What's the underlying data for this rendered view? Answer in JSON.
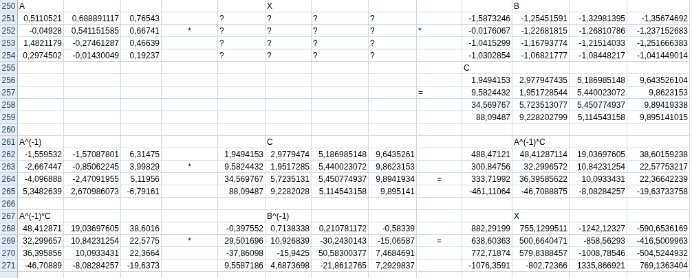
{
  "rows": [
    {
      "number": "250",
      "cells": [
        {
          "kind": "label",
          "text": "A"
        },
        null,
        null,
        null,
        null,
        {
          "kind": "label",
          "text": "X"
        },
        null,
        null,
        null,
        null,
        {
          "kind": "label",
          "text": "B"
        },
        null,
        null
      ]
    },
    {
      "number": "251",
      "cells": [
        {
          "kind": "number",
          "text": "0,5110521"
        },
        {
          "kind": "number",
          "text": "0,688891117"
        },
        {
          "kind": "number",
          "text": "0,76543"
        },
        null,
        {
          "kind": "label",
          "text": "?"
        },
        {
          "kind": "label",
          "text": "?"
        },
        {
          "kind": "label",
          "text": "?"
        },
        {
          "kind": "label",
          "text": "?"
        },
        null,
        {
          "kind": "number",
          "text": "-1,5873246"
        },
        {
          "kind": "number",
          "text": "-1,25451591"
        },
        {
          "kind": "number",
          "text": "-1,32981395"
        },
        {
          "kind": "number",
          "text": "-1,35674692"
        }
      ]
    },
    {
      "number": "252",
      "cells": [
        {
          "kind": "number",
          "text": "-0,04928"
        },
        {
          "kind": "number",
          "text": "0,541151585"
        },
        {
          "kind": "number",
          "text": "0,66741"
        },
        {
          "kind": "operator",
          "text": "*"
        },
        {
          "kind": "label",
          "text": "?"
        },
        {
          "kind": "label",
          "text": "?"
        },
        {
          "kind": "label",
          "text": "?"
        },
        {
          "kind": "label",
          "text": "?"
        },
        {
          "kind": "label",
          "text": "*"
        },
        {
          "kind": "number",
          "text": "-0,0176067"
        },
        {
          "kind": "number",
          "text": "-1,22681815"
        },
        {
          "kind": "number",
          "text": "-1,26810786"
        },
        {
          "kind": "number",
          "text": "-1,237152683"
        }
      ]
    },
    {
      "number": "253",
      "cells": [
        {
          "kind": "number",
          "text": "1,4821179"
        },
        {
          "kind": "number",
          "text": "-0,27461287"
        },
        {
          "kind": "number",
          "text": "0,46639"
        },
        null,
        {
          "kind": "label",
          "text": "?"
        },
        {
          "kind": "label",
          "text": "?"
        },
        {
          "kind": "label",
          "text": "?"
        },
        {
          "kind": "label",
          "text": "?"
        },
        null,
        {
          "kind": "number",
          "text": "-1,0415299"
        },
        {
          "kind": "number",
          "text": "-1,16793774"
        },
        {
          "kind": "number",
          "text": "-1,21514033"
        },
        {
          "kind": "number",
          "text": "-1,251666383"
        }
      ]
    },
    {
      "number": "254",
      "cells": [
        {
          "kind": "number",
          "text": "0,2974502"
        },
        {
          "kind": "number",
          "text": "-0,01430049"
        },
        {
          "kind": "number",
          "text": "0,19237"
        },
        null,
        {
          "kind": "label",
          "text": "?"
        },
        {
          "kind": "label",
          "text": "?"
        },
        {
          "kind": "label",
          "text": "?"
        },
        {
          "kind": "label",
          "text": "?"
        },
        null,
        {
          "kind": "number",
          "text": "-1,0302854"
        },
        {
          "kind": "number",
          "text": "-1,06821777"
        },
        {
          "kind": "number",
          "text": "-1,08448217"
        },
        {
          "kind": "number",
          "text": "-1,041449014"
        }
      ]
    },
    {
      "number": "255",
      "cells": [
        null,
        null,
        null,
        null,
        null,
        null,
        null,
        null,
        null,
        {
          "kind": "label",
          "text": "C"
        },
        null,
        null,
        null
      ]
    },
    {
      "number": "256",
      "cells": [
        null,
        null,
        null,
        null,
        null,
        null,
        null,
        null,
        null,
        {
          "kind": "number",
          "text": "1,9494153"
        },
        {
          "kind": "number",
          "text": "2,977947435"
        },
        {
          "kind": "number",
          "text": "5,186985148"
        },
        {
          "kind": "number",
          "text": "9,643526104"
        }
      ]
    },
    {
      "number": "257",
      "cells": [
        null,
        null,
        null,
        null,
        null,
        null,
        null,
        null,
        {
          "kind": "label",
          "text": "="
        },
        {
          "kind": "number",
          "text": "9,5824432"
        },
        {
          "kind": "number",
          "text": "1,951728544"
        },
        {
          "kind": "number",
          "text": "5,440023072"
        },
        {
          "kind": "number",
          "text": "9,8623153"
        }
      ]
    },
    {
      "number": "258",
      "cells": [
        null,
        null,
        null,
        null,
        null,
        null,
        null,
        null,
        null,
        {
          "kind": "number",
          "text": "34,569767"
        },
        {
          "kind": "number",
          "text": "5,723513077"
        },
        {
          "kind": "number",
          "text": "5,450774937"
        },
        {
          "kind": "number",
          "text": "9,89419338"
        }
      ]
    },
    {
      "number": "259",
      "cells": [
        null,
        null,
        null,
        null,
        null,
        null,
        null,
        null,
        null,
        {
          "kind": "number",
          "text": "88,09487"
        },
        {
          "kind": "number",
          "text": "9,228202799"
        },
        {
          "kind": "number",
          "text": "5,114543158"
        },
        {
          "kind": "number",
          "text": "9,895141015"
        }
      ]
    },
    {
      "number": "260",
      "cells": [
        null,
        null,
        null,
        null,
        null,
        null,
        null,
        null,
        null,
        null,
        null,
        null,
        null
      ]
    },
    {
      "number": "261",
      "cells": [
        {
          "kind": "label",
          "text": "A^(-1)"
        },
        null,
        null,
        null,
        null,
        {
          "kind": "label",
          "text": "C"
        },
        null,
        null,
        null,
        null,
        {
          "kind": "label",
          "text": "A^(-1)*C"
        },
        null,
        null
      ]
    },
    {
      "number": "262",
      "cells": [
        {
          "kind": "number",
          "text": "-1,559532"
        },
        {
          "kind": "number",
          "text": "-1,57087801"
        },
        {
          "kind": "number",
          "text": "6,31475"
        },
        null,
        {
          "kind": "number",
          "text": "1,9494153"
        },
        {
          "kind": "number",
          "text": "2,9779474"
        },
        {
          "kind": "number",
          "text": "5,186985148"
        },
        {
          "kind": "number",
          "text": "9,6435261"
        },
        null,
        {
          "kind": "number",
          "text": "488,47121"
        },
        {
          "kind": "number",
          "text": "48,41287114"
        },
        {
          "kind": "number",
          "text": "19,03697605"
        },
        {
          "kind": "number",
          "text": "38,60159238"
        }
      ]
    },
    {
      "number": "263",
      "cells": [
        {
          "kind": "number",
          "text": "-2,667447"
        },
        {
          "kind": "number",
          "text": "-0,85062245"
        },
        {
          "kind": "number",
          "text": "3,99829"
        },
        {
          "kind": "operator",
          "text": "*"
        },
        {
          "kind": "number",
          "text": "9,5824432"
        },
        {
          "kind": "number",
          "text": "1,9517285"
        },
        {
          "kind": "number",
          "text": "5,440023072"
        },
        {
          "kind": "number",
          "text": "9,8623153"
        },
        null,
        {
          "kind": "number",
          "text": "300,84756"
        },
        {
          "kind": "number",
          "text": "32,2996572"
        },
        {
          "kind": "number",
          "text": "10,84231254"
        },
        {
          "kind": "number",
          "text": "22,57753217"
        }
      ]
    },
    {
      "number": "264",
      "cells": [
        {
          "kind": "number",
          "text": "-4,096888"
        },
        {
          "kind": "number",
          "text": "-2,47091955"
        },
        {
          "kind": "number",
          "text": "5,11956"
        },
        null,
        {
          "kind": "number",
          "text": "34,569767"
        },
        {
          "kind": "number",
          "text": "5,7235131"
        },
        {
          "kind": "number",
          "text": "5,450774937"
        },
        {
          "kind": "number",
          "text": "9,8941934"
        },
        {
          "kind": "operator",
          "text": "="
        },
        {
          "kind": "number",
          "text": "333,71992"
        },
        {
          "kind": "number",
          "text": "36,39585622"
        },
        {
          "kind": "number",
          "text": "10,0933431"
        },
        {
          "kind": "number",
          "text": "22,36642239"
        }
      ]
    },
    {
      "number": "265",
      "cells": [
        {
          "kind": "number",
          "text": "5,3482639"
        },
        {
          "kind": "number",
          "text": "2,670986073"
        },
        {
          "kind": "number",
          "text": "-6,79161"
        },
        null,
        {
          "kind": "number",
          "text": "88,09487"
        },
        {
          "kind": "number",
          "text": "9,2282028"
        },
        {
          "kind": "number",
          "text": "5,114543158"
        },
        {
          "kind": "number",
          "text": "9,895141"
        },
        null,
        {
          "kind": "number",
          "text": "-461,11064"
        },
        {
          "kind": "number",
          "text": "-46,7088875"
        },
        {
          "kind": "number",
          "text": "-8,08284257"
        },
        {
          "kind": "number",
          "text": "-19,63733758"
        }
      ]
    },
    {
      "number": "266",
      "cells": [
        null,
        null,
        null,
        null,
        null,
        null,
        null,
        null,
        null,
        null,
        null,
        null,
        null
      ]
    },
    {
      "number": "267",
      "cells": [
        {
          "kind": "label",
          "text": "A^(-1)*C"
        },
        null,
        null,
        null,
        null,
        {
          "kind": "label",
          "text": "B^(-1)"
        },
        null,
        null,
        null,
        null,
        {
          "kind": "label",
          "text": "X"
        },
        null,
        null
      ]
    },
    {
      "number": "268",
      "cells": [
        {
          "kind": "number",
          "text": "48,412871"
        },
        {
          "kind": "number",
          "text": "19,03697605"
        },
        {
          "kind": "number",
          "text": "38,6016"
        },
        null,
        {
          "kind": "number",
          "text": "-0,397552"
        },
        {
          "kind": "number",
          "text": "0,7138338"
        },
        {
          "kind": "number",
          "text": "0,210781172"
        },
        {
          "kind": "number",
          "text": "-0,58339"
        },
        null,
        {
          "kind": "number",
          "text": "882,29199"
        },
        {
          "kind": "number",
          "text": "755,1299511"
        },
        {
          "kind": "number",
          "text": "-1242,12327"
        },
        {
          "kind": "number",
          "text": "-590,6536169"
        }
      ]
    },
    {
      "number": "269",
      "cells": [
        {
          "kind": "number",
          "text": "32,299657"
        },
        {
          "kind": "number",
          "text": "10,84231254"
        },
        {
          "kind": "number",
          "text": "22,5775"
        },
        {
          "kind": "operator",
          "text": "*"
        },
        {
          "kind": "number",
          "text": "29,501696"
        },
        {
          "kind": "number",
          "text": "10,926839"
        },
        {
          "kind": "number",
          "text": "-30,2430143"
        },
        {
          "kind": "number",
          "text": "-15,06587"
        },
        {
          "kind": "operator",
          "text": "="
        },
        {
          "kind": "number",
          "text": "638,60363"
        },
        {
          "kind": "number",
          "text": "500,6640471"
        },
        {
          "kind": "number",
          "text": "-858,56293"
        },
        {
          "kind": "number",
          "text": "-416,5009963"
        }
      ]
    },
    {
      "number": "270",
      "cells": [
        {
          "kind": "number",
          "text": "36,395856"
        },
        {
          "kind": "number",
          "text": "10,0933431"
        },
        {
          "kind": "number",
          "text": "22,3664"
        },
        null,
        {
          "kind": "number",
          "text": "-37,86098"
        },
        {
          "kind": "number",
          "text": "-15,9425"
        },
        {
          "kind": "number",
          "text": "50,58300377"
        },
        {
          "kind": "number",
          "text": "7,4684691"
        },
        null,
        {
          "kind": "number",
          "text": "772,71874"
        },
        {
          "kind": "number",
          "text": "579,8388457"
        },
        {
          "kind": "number",
          "text": "-1008,78546"
        },
        {
          "kind": "number",
          "text": "-504,5244932"
        }
      ]
    },
    {
      "number": "271",
      "cells": [
        {
          "kind": "number",
          "text": "-46,70889"
        },
        {
          "kind": "number",
          "text": "-8,08284257"
        },
        {
          "kind": "number",
          "text": "-19,6373"
        },
        null,
        {
          "kind": "number",
          "text": "9,5587186"
        },
        {
          "kind": "number",
          "text": "4,6873698"
        },
        {
          "kind": "number",
          "text": "-21,8612765"
        },
        {
          "kind": "number",
          "text": "7,2929837"
        },
        null,
        {
          "kind": "number",
          "text": "-1076,3591"
        },
        {
          "kind": "number",
          "text": "-802,72366"
        },
        {
          "kind": "number",
          "text": "1335,866921"
        },
        {
          "kind": "number",
          "text": "769,1363404"
        }
      ]
    }
  ]
}
